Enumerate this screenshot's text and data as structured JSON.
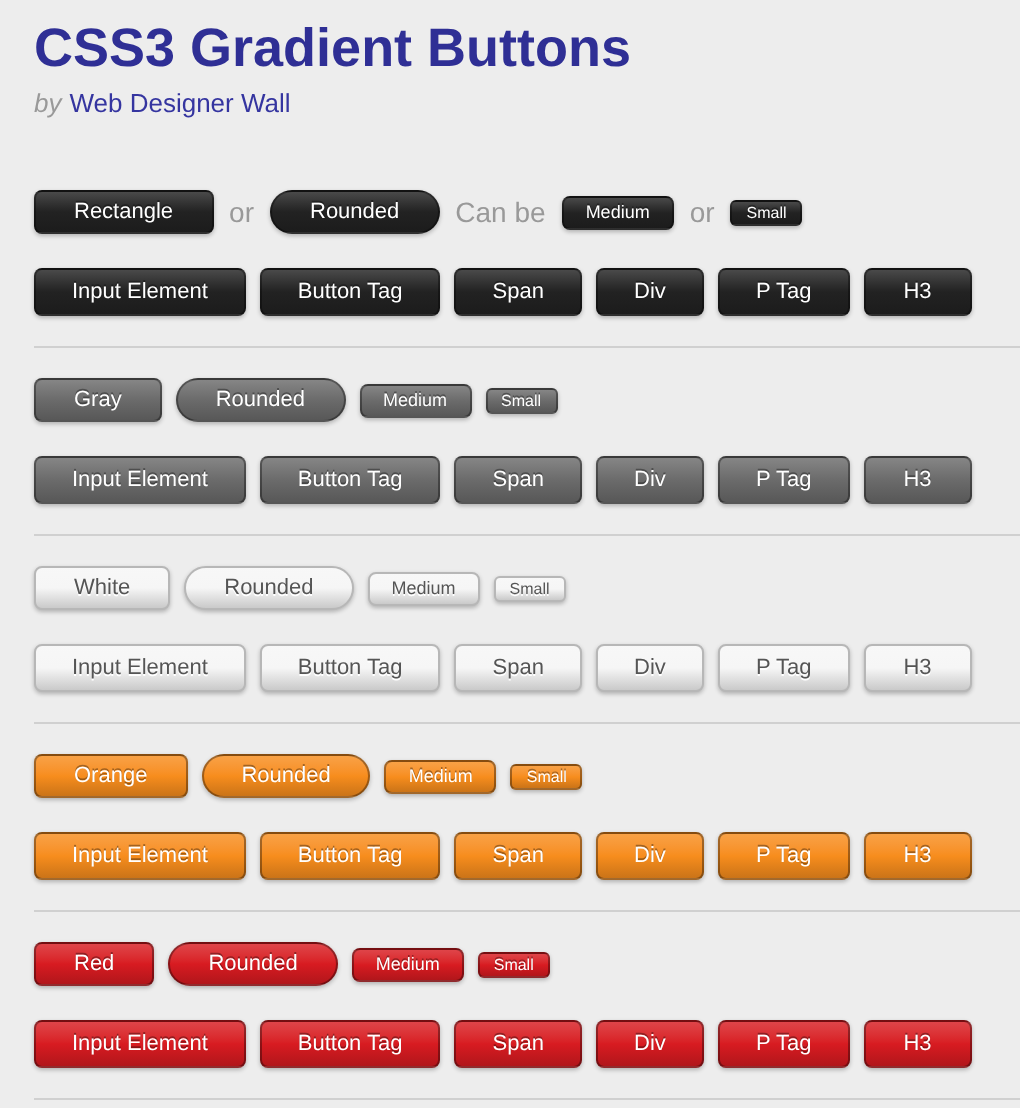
{
  "title": "CSS3 Gradient Buttons",
  "byline": {
    "prefix": "by",
    "author": "Web Designer Wall"
  },
  "sections": [
    {
      "color": "#222222",
      "top": [
        {
          "kind": "rectangle",
          "label": "Rectangle"
        },
        {
          "kind": "text",
          "label": "or"
        },
        {
          "kind": "pill",
          "label": "Rounded"
        },
        {
          "kind": "text",
          "label": "Can be"
        },
        {
          "kind": "medium",
          "label": "Medium"
        },
        {
          "kind": "text",
          "label": "or"
        },
        {
          "kind": "small",
          "label": "Small"
        }
      ],
      "elements": [
        "Input Element",
        "Button Tag",
        "Span",
        "Div",
        "P Tag",
        "H3"
      ]
    },
    {
      "color": "#6b6b6b",
      "top": [
        {
          "kind": "rectangle",
          "label": "Gray"
        },
        {
          "kind": "pill",
          "label": "Rounded"
        },
        {
          "kind": "medium",
          "label": "Medium"
        },
        {
          "kind": "small",
          "label": "Small"
        }
      ],
      "elements": [
        "Input Element",
        "Button Tag",
        "Span",
        "Div",
        "P Tag",
        "H3"
      ]
    },
    {
      "color": "#f6f6f6",
      "top": [
        {
          "kind": "rectangle",
          "label": "White"
        },
        {
          "kind": "pill",
          "label": "Rounded"
        },
        {
          "kind": "medium",
          "label": "Medium"
        },
        {
          "kind": "small",
          "label": "Small"
        }
      ],
      "elements": [
        "Input Element",
        "Button Tag",
        "Span",
        "Div",
        "P Tag",
        "H3"
      ]
    },
    {
      "color": "#f78d1d",
      "top": [
        {
          "kind": "rectangle",
          "label": "Orange"
        },
        {
          "kind": "pill",
          "label": "Rounded"
        },
        {
          "kind": "medium",
          "label": "Medium"
        },
        {
          "kind": "small",
          "label": "Small"
        }
      ],
      "elements": [
        "Input Element",
        "Button Tag",
        "Span",
        "Div",
        "P Tag",
        "H3"
      ]
    },
    {
      "color": "#d81b21",
      "top": [
        {
          "kind": "rectangle",
          "label": "Red"
        },
        {
          "kind": "pill",
          "label": "Rounded"
        },
        {
          "kind": "medium",
          "label": "Medium"
        },
        {
          "kind": "small",
          "label": "Small"
        }
      ],
      "elements": [
        "Input Element",
        "Button Tag",
        "Span",
        "Div",
        "P Tag",
        "H3"
      ]
    }
  ]
}
